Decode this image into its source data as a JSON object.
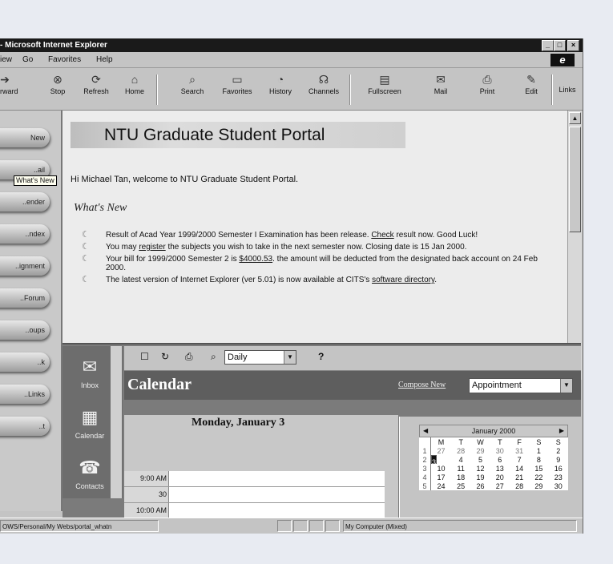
{
  "window": {
    "title": "- Microsoft Internet Explorer",
    "menu": [
      "iew",
      "Go",
      "Favorites",
      "Help"
    ]
  },
  "toolbar": {
    "buttons": [
      {
        "label": "Forward",
        "icon": "forward-arrow-icon"
      },
      {
        "label": "Stop",
        "icon": "stop-icon"
      },
      {
        "label": "Refresh",
        "icon": "refresh-icon"
      },
      {
        "label": "Home",
        "icon": "home-icon"
      },
      {
        "label": "Search",
        "icon": "search-icon"
      },
      {
        "label": "Favorites",
        "icon": "favorites-icon"
      },
      {
        "label": "History",
        "icon": "history-icon"
      },
      {
        "label": "Channels",
        "icon": "channels-icon"
      },
      {
        "label": "Fullscreen",
        "icon": "fullscreen-icon"
      },
      {
        "label": "Mail",
        "icon": "mail-icon"
      },
      {
        "label": "Print",
        "icon": "print-icon"
      },
      {
        "label": "Edit",
        "icon": "edit-icon"
      },
      {
        "label": "Links",
        "icon": ""
      }
    ]
  },
  "sidebar": {
    "items": [
      "New",
      "..ail",
      "..ender",
      "..ndex",
      "..ignment",
      "..Forum",
      "..oups",
      "..k",
      "..Links",
      "..t"
    ],
    "tooltip": "What's New"
  },
  "portal": {
    "title": "NTU Graduate Student Portal",
    "welcome": "Hi Michael Tan, welcome to NTU Graduate Student Portal.",
    "whats_new": "What's New",
    "news": [
      {
        "pre": "Result of Acad Year 1999/2000 Semester I Examination has been release. ",
        "link": "Check",
        "post": " result now. Good Luck!"
      },
      {
        "pre": "You may ",
        "link": "register",
        "post": " the subjects you wish to take in the next semester now. Closing date is 15 Jan 2000."
      },
      {
        "pre": "Your bill for 1999/2000 Semester 2 is ",
        "link": "$4000.53",
        "post": ". the amount will be deducted from the designated back account on 24 Feb 2000."
      },
      {
        "pre": "The latest version of Internet Explorer (ver 5.01) is now available at CITS's ",
        "link": "software directory",
        "post": "."
      }
    ]
  },
  "outlook": {
    "bar": [
      {
        "label": "Inbox",
        "icon": "inbox-icon"
      },
      {
        "label": "Calendar",
        "icon": "calendar-icon"
      },
      {
        "label": "Contacts",
        "icon": "contacts-icon"
      }
    ],
    "view_select": "Daily",
    "help_icon": "?",
    "calendar_title": "Calendar",
    "compose_label": "Compose New",
    "compose_select": "Appointment",
    "day_title": "Monday, January 3",
    "slots": [
      "9:00 AM",
      "30",
      "10:00 AM"
    ],
    "mini": {
      "month": "January 2000",
      "days_header": [
        "M",
        "T",
        "W",
        "T",
        "F",
        "S",
        "S"
      ],
      "weeks": [
        {
          "wk": "1",
          "days": [
            "27",
            "28",
            "29",
            "30",
            "31",
            "1",
            "2"
          ]
        },
        {
          "wk": "2",
          "days": [
            "3",
            "4",
            "5",
            "6",
            "7",
            "8",
            "9"
          ]
        },
        {
          "wk": "3",
          "days": [
            "10",
            "11",
            "12",
            "13",
            "14",
            "15",
            "16"
          ]
        },
        {
          "wk": "4",
          "days": [
            "17",
            "18",
            "19",
            "20",
            "21",
            "22",
            "23"
          ]
        },
        {
          "wk": "5",
          "days": [
            "24",
            "25",
            "26",
            "27",
            "28",
            "29",
            "30"
          ]
        }
      ],
      "selected": "3"
    }
  },
  "status": {
    "url": "OWS/Personal/My Webs/portal_whatn",
    "zone": "My Computer (Mixed)"
  }
}
